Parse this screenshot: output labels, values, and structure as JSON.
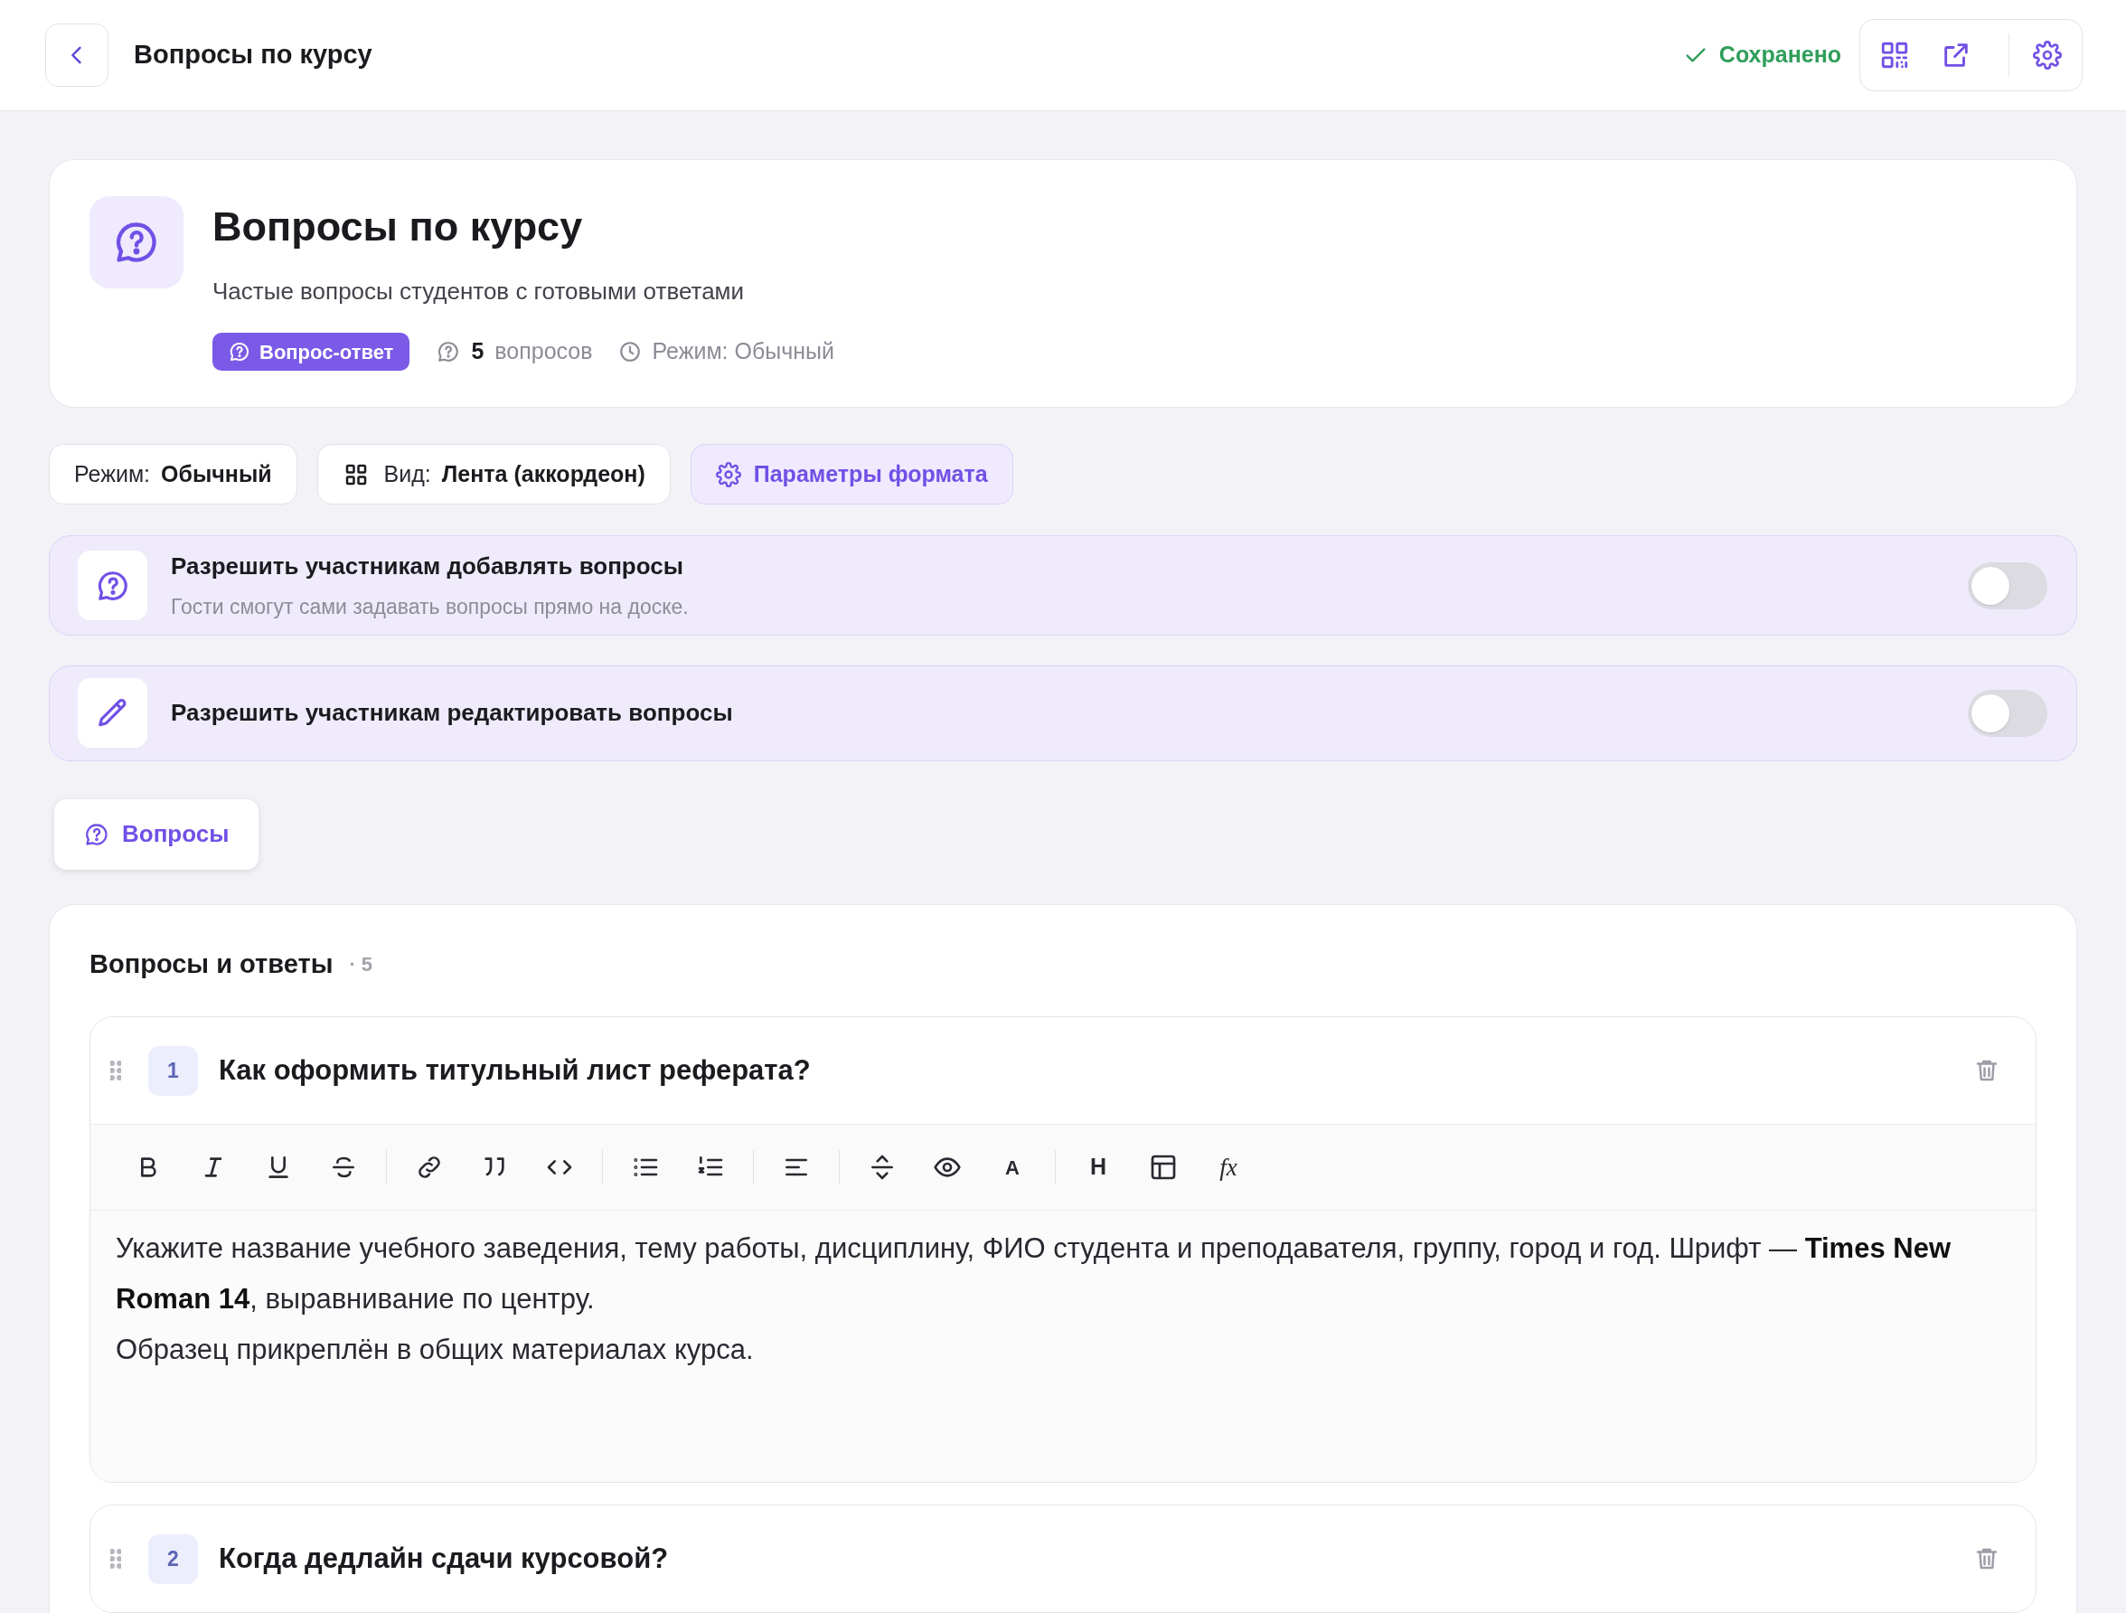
{
  "topbar": {
    "title": "Вопросы по курсу",
    "status": "Сохранено"
  },
  "header": {
    "title": "Вопросы по курсу",
    "subtitle": "Частые вопросы студентов с готовыми ответами",
    "badge": "Вопрос-ответ",
    "count": "5",
    "count_label": "вопросов",
    "mode": "Режим: Обычный"
  },
  "chips": [
    {
      "kind": "mode",
      "label": "Режим:",
      "value": "Обычный"
    },
    {
      "kind": "view",
      "label": "Вид:",
      "value": "Лента (аккордеон)"
    },
    {
      "kind": "settings",
      "label": "Параметры формата"
    }
  ],
  "toggles": [
    {
      "kind": "question",
      "title": "Разрешить участникам добавлять вопросы",
      "description": "Гости смогут сами задавать вопросы прямо на доске.",
      "on": false
    },
    {
      "kind": "pencil",
      "title": "Разрешить участникам редактировать вопросы",
      "on": false
    }
  ],
  "tabs": [
    {
      "label": "Вопросы",
      "selected": true
    }
  ],
  "qa": {
    "title": "Вопросы и ответы",
    "count": "· 5",
    "items": [
      {
        "number": "1",
        "question": "Как оформить титульный лист реферата?",
        "expanded": true,
        "answer": [
          "Укажите название учебного заведения, тему работы, дисциплину, ФИО студента и преподавателя, группу, город и год. Шрифт — **Times New Roman 14**, выравнивание по центру.",
          "Образец прикреплён в общих материалах курса."
        ]
      },
      {
        "number": "2",
        "question": "Когда дедлайн сдачи курсовой?",
        "expanded": false
      }
    ]
  },
  "toolbar": [
    {
      "kind": "bold"
    },
    {
      "kind": "italic"
    },
    {
      "kind": "underline"
    },
    {
      "kind": "strike"
    },
    {
      "kind": "sep"
    },
    {
      "kind": "link"
    },
    {
      "kind": "quote"
    },
    {
      "kind": "code"
    },
    {
      "kind": "sep"
    },
    {
      "kind": "bullets"
    },
    {
      "kind": "numbers"
    },
    {
      "kind": "sep"
    },
    {
      "kind": "align"
    },
    {
      "kind": "sep"
    },
    {
      "kind": "expand"
    },
    {
      "kind": "eye"
    },
    {
      "kind": "color",
      "label": "A"
    },
    {
      "kind": "sep"
    },
    {
      "kind": "heading",
      "label": "H"
    },
    {
      "kind": "table"
    },
    {
      "kind": "formula",
      "label": "fx"
    }
  ]
}
